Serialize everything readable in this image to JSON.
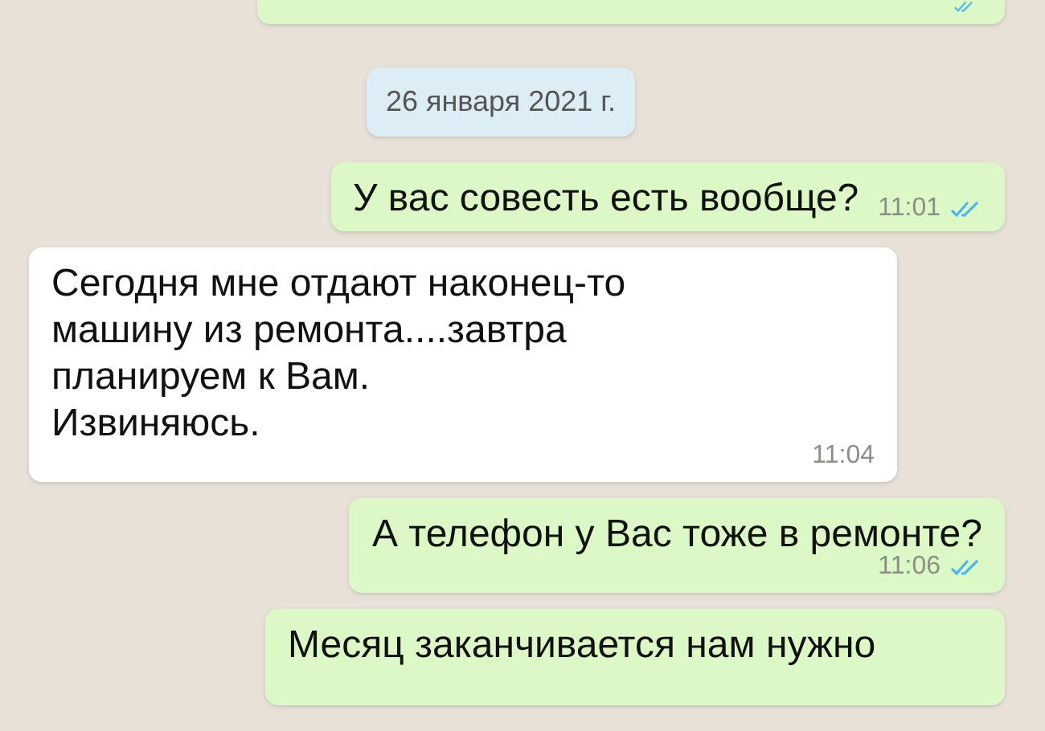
{
  "messages": [
    {
      "kind": "message",
      "outgoing": true,
      "read": true
    },
    {
      "kind": "date",
      "text": "26 января 2021 г."
    },
    {
      "kind": "message",
      "outgoing": true,
      "text": "У вас совесть есть вообще?",
      "time": "11:01",
      "read": true
    },
    {
      "kind": "message",
      "outgoing": false,
      "text": "Сегодня мне отдают наконец-то\nмашину из ремонта....завтра\nпланируем к Вам.\nИзвиняюсь.",
      "time": "11:04"
    },
    {
      "kind": "message",
      "outgoing": true,
      "text": "А телефон у Вас тоже в ремонте?",
      "time": "11:06",
      "read": true
    },
    {
      "kind": "message",
      "outgoing": true,
      "text": "Месяц заканчивается нам нужно"
    }
  ]
}
